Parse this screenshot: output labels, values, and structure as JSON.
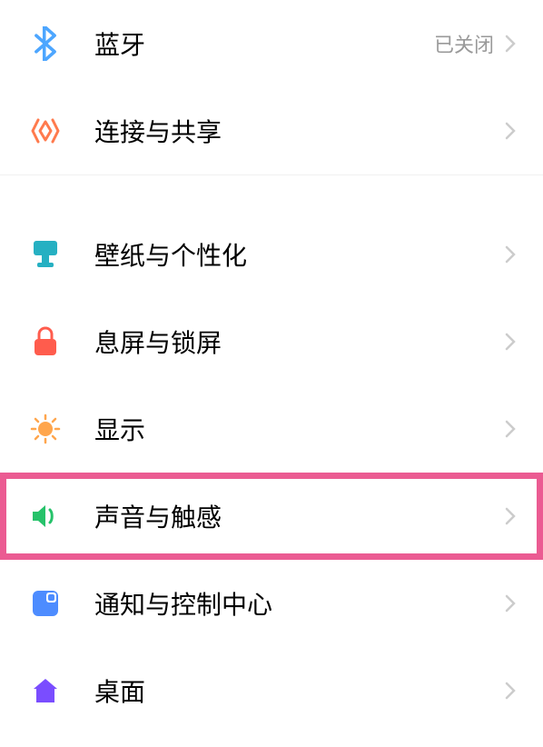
{
  "settings": {
    "groups": [
      {
        "items": [
          {
            "id": "bluetooth",
            "icon": "bluetooth-icon",
            "label": "蓝牙",
            "status": "已关闭"
          },
          {
            "id": "connection-sharing",
            "icon": "connection-icon",
            "label": "连接与共享",
            "status": ""
          }
        ]
      },
      {
        "items": [
          {
            "id": "wallpaper",
            "icon": "wallpaper-icon",
            "label": "壁纸与个性化",
            "status": ""
          },
          {
            "id": "lockscreen",
            "icon": "lock-icon",
            "label": "息屏与锁屏",
            "status": ""
          },
          {
            "id": "display",
            "icon": "sun-icon",
            "label": "显示",
            "status": ""
          },
          {
            "id": "sound",
            "icon": "sound-icon",
            "label": "声音与触感",
            "status": "",
            "highlighted": true
          },
          {
            "id": "notification",
            "icon": "notification-icon",
            "label": "通知与控制中心",
            "status": ""
          },
          {
            "id": "desktop",
            "icon": "home-icon",
            "label": "桌面",
            "status": ""
          }
        ]
      }
    ]
  },
  "colors": {
    "highlight": "#eb5b92",
    "bluetooth": "#4da6ff",
    "connection": "#ff7a4d",
    "wallpaper": "#26b0c2",
    "lock": "#ff5c4d",
    "sun": "#ffa64d",
    "sound": "#26c26a",
    "notification": "#4d8cff",
    "home": "#7a4dff"
  }
}
